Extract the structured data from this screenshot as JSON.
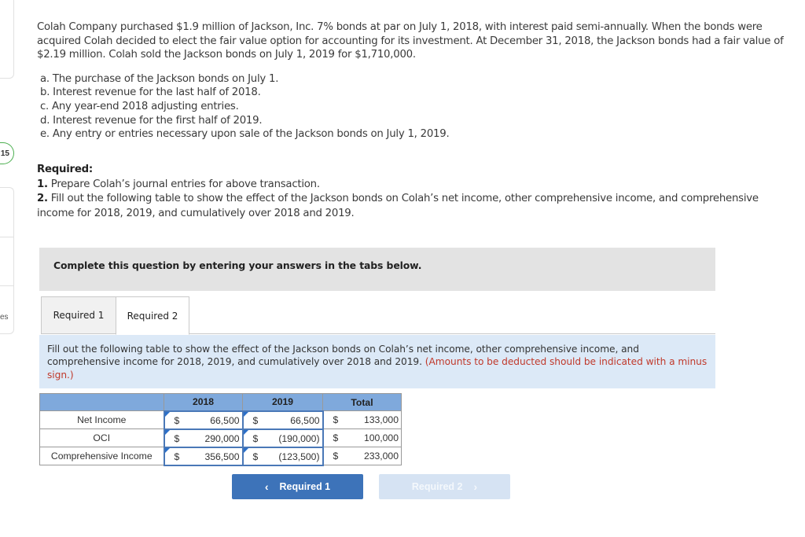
{
  "sidebar": {
    "question_number": "15",
    "fragment_label": "es"
  },
  "problem": {
    "intro": "Colah Company purchased $1.9 million of Jackson, Inc. 7% bonds at par on July 1, 2018, with interest paid semi-annually. When the bonds were acquired Colah decided to elect the fair value option for accounting for its investment. At December 31, 2018, the Jackson bonds had a fair value of $2.19 million. Colah sold the Jackson bonds on July 1, 2019 for $1,710,000.",
    "parts": [
      "a. The purchase of the Jackson bonds on July 1.",
      "b. Interest revenue for the last half of 2018.",
      "c. Any year-end 2018 adjusting entries.",
      "d. Interest revenue for the first half of 2019.",
      "e. Any entry or entries necessary upon sale of the Jackson bonds on July 1, 2019."
    ],
    "required_label": "Required:",
    "required_items": [
      {
        "num": "1.",
        "text": " Prepare Colah’s journal entries for above transaction."
      },
      {
        "num": "2.",
        "text": " Fill out the following table to show the effect of the Jackson bonds on Colah’s net income, other comprehensive income, and comprehensive income for 2018, 2019, and cumulatively over 2018 and 2019."
      }
    ]
  },
  "instructions": "Complete this question by entering your answers in the tabs below.",
  "tabs": [
    {
      "label": "Required 1",
      "active": false
    },
    {
      "label": "Required 2",
      "active": true
    }
  ],
  "tab_description": {
    "text": "Fill out the following table to show the effect of the Jackson bonds on Colah’s net income, other comprehensive income, and comprehensive income for 2018, 2019, and cumulatively over 2018 and 2019. ",
    "note": "(Amounts to be deducted should be indicated with a minus sign.)"
  },
  "table": {
    "headers": [
      "",
      "2018",
      "2019",
      "Total"
    ],
    "currency": "$",
    "rows": [
      {
        "label": "Net Income",
        "y2018": "66,500",
        "y2019": "66,500",
        "total": "133,000"
      },
      {
        "label": "OCI",
        "y2018": "290,000",
        "y2019": "(190,000)",
        "total": "100,000"
      },
      {
        "label": "Comprehensive Income",
        "y2018": "356,500",
        "y2019": "(123,500)",
        "total": "233,000"
      }
    ]
  },
  "nav": {
    "prev_label": "Required 1",
    "next_label": "Required 2",
    "prev_icon": "‹",
    "next_icon": "›"
  },
  "colors": {
    "accent": "#3d73b9",
    "header_blue": "#7fa9dc",
    "note_red": "#c0392b",
    "badge_green": "#4caf50"
  }
}
